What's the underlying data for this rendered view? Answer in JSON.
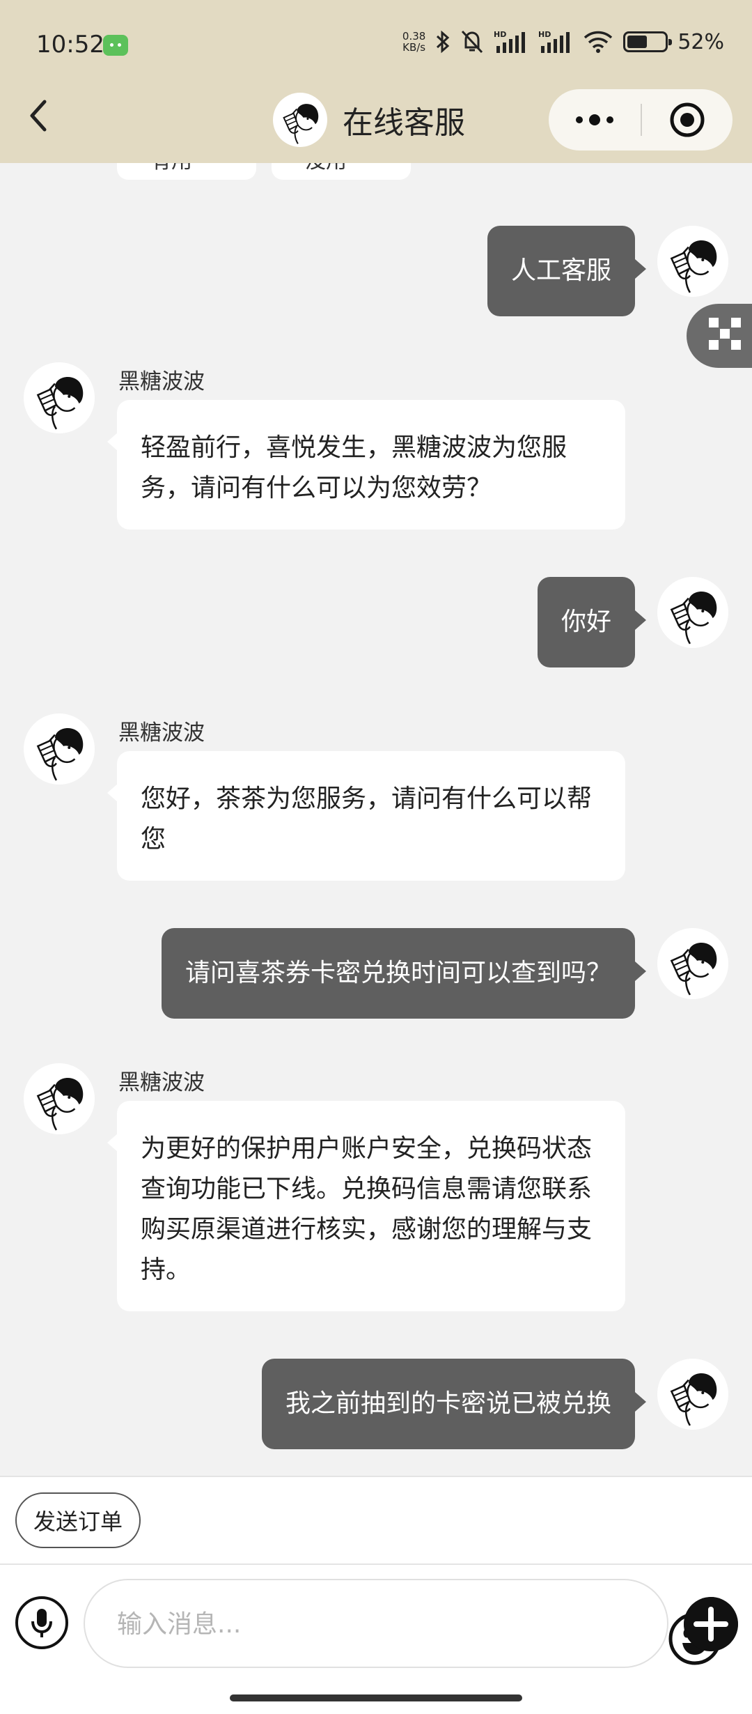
{
  "status_bar": {
    "time": "10:52",
    "net_speed_value": "0.38",
    "net_speed_unit": "KB/s",
    "battery_text": "52%",
    "icons": [
      "android-icon",
      "bluetooth-icon",
      "mute-icon",
      "hd-signal-icon",
      "hd-signal-icon",
      "wifi-icon",
      "battery-icon"
    ]
  },
  "header": {
    "title": "在线客服",
    "back_icon": "chevron-left-icon",
    "more_icon": "more-dots-icon",
    "close_icon": "target-icon"
  },
  "chat": {
    "top_chips": [
      "有用",
      "没用"
    ],
    "messages": [
      {
        "side": "out",
        "text": "人工客服"
      },
      {
        "side": "in",
        "sender": "黑糖波波",
        "text": "轻盈前行，喜悦发生，黑糖波波为您服务，请问有什么可以为您效劳？"
      },
      {
        "side": "out",
        "text": "你好"
      },
      {
        "side": "in",
        "sender": "黑糖波波",
        "text": "您好，茶茶为您服务，请问有什么可以帮您"
      },
      {
        "side": "out",
        "text": "请问喜茶券卡密兑换时间可以查到吗？"
      },
      {
        "side": "in",
        "sender": "黑糖波波",
        "text": "为更好的保护用户账户安全，兑换码状态查询功能已下线。兑换码信息需请您联系购买原渠道进行核实，感谢您的理解与支持。"
      },
      {
        "side": "out",
        "text": "我之前抽到的卡密说已被兑换"
      }
    ]
  },
  "quick_actions": {
    "send_order": "发送订单"
  },
  "input_bar": {
    "placeholder": "输入消息...",
    "voice_icon": "microphone-icon",
    "emoji_icon": "emoji-icon",
    "plus_icon": "plus-icon"
  },
  "colors": {
    "header_bg": "#e2dac2",
    "chat_bg": "#f2f2f2",
    "outgoing_bubble": "#5f5f5f",
    "incoming_bubble": "#ffffff"
  }
}
